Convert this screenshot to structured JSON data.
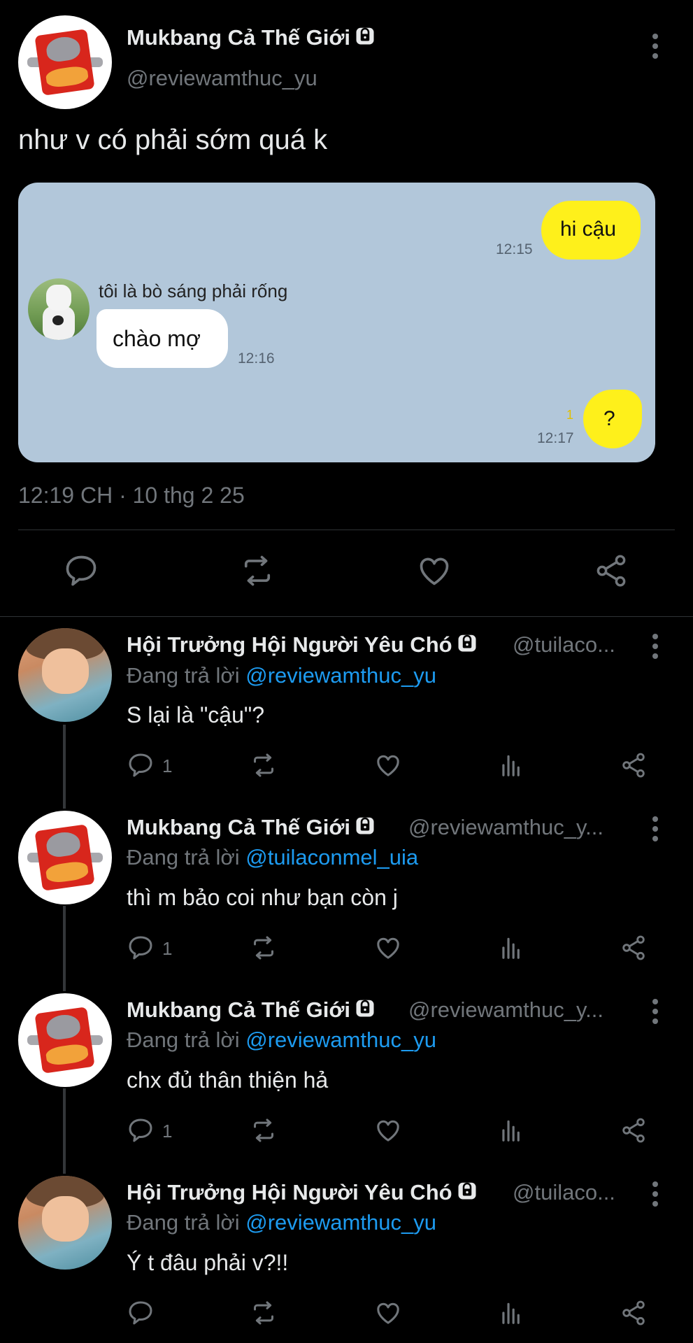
{
  "main_tweet": {
    "display_name": "Mukbang Cả Thế Giới",
    "handle": "@reviewamthuc_yu",
    "text": "như v có phải sớm quá k",
    "timestamp": "12:19 CH · 10 thg 2 25",
    "avatar_icon": "instant-noodle-pack-avatar",
    "chat_image": {
      "background": "#b2c7da",
      "messages": [
        {
          "side": "right",
          "text": "hi cậu",
          "time": "12:15"
        },
        {
          "side": "left",
          "sender": "tôi là bò sáng phải rống",
          "text": "chào mợ",
          "time": "12:16"
        },
        {
          "side": "right",
          "text": "?",
          "time": "12:17",
          "unread": "1"
        }
      ]
    }
  },
  "replies": [
    {
      "display_name": "Hội Trưởng Hội Người Yêu Chó",
      "handle": "@tuilaco...",
      "reply_prefix": "Đang trả lời",
      "reply_to": "@reviewamthuc_yu",
      "text": "S lại là \"cậu\"?",
      "reply_count": "1",
      "avatar": "person"
    },
    {
      "display_name": "Mukbang Cả Thế Giới",
      "handle": "@reviewamthuc_y...",
      "reply_prefix": "Đang trả lời",
      "reply_to": "@tuilaconmel_uia",
      "text": "thì m bảo coi như bạn còn j",
      "reply_count": "1",
      "avatar": "mukbang"
    },
    {
      "display_name": "Mukbang Cả Thế Giới",
      "handle": "@reviewamthuc_y...",
      "reply_prefix": "Đang trả lời",
      "reply_to": "@reviewamthuc_yu",
      "text": "chx đủ thân thiện hả",
      "reply_count": "1",
      "avatar": "mukbang"
    },
    {
      "display_name": "Hội Trưởng Hội Người Yêu Chó",
      "handle": "@tuilaco...",
      "reply_prefix": "Đang trả lời",
      "reply_to": "@reviewamthuc_yu",
      "text": "Ý t đâu phải v?!!",
      "reply_count": "",
      "avatar": "person"
    }
  ],
  "colors": {
    "background": "#000000",
    "text": "#e7e9ea",
    "muted": "#71767b",
    "mention": "#1d9bf0",
    "kakao_yellow": "#fef01b"
  }
}
